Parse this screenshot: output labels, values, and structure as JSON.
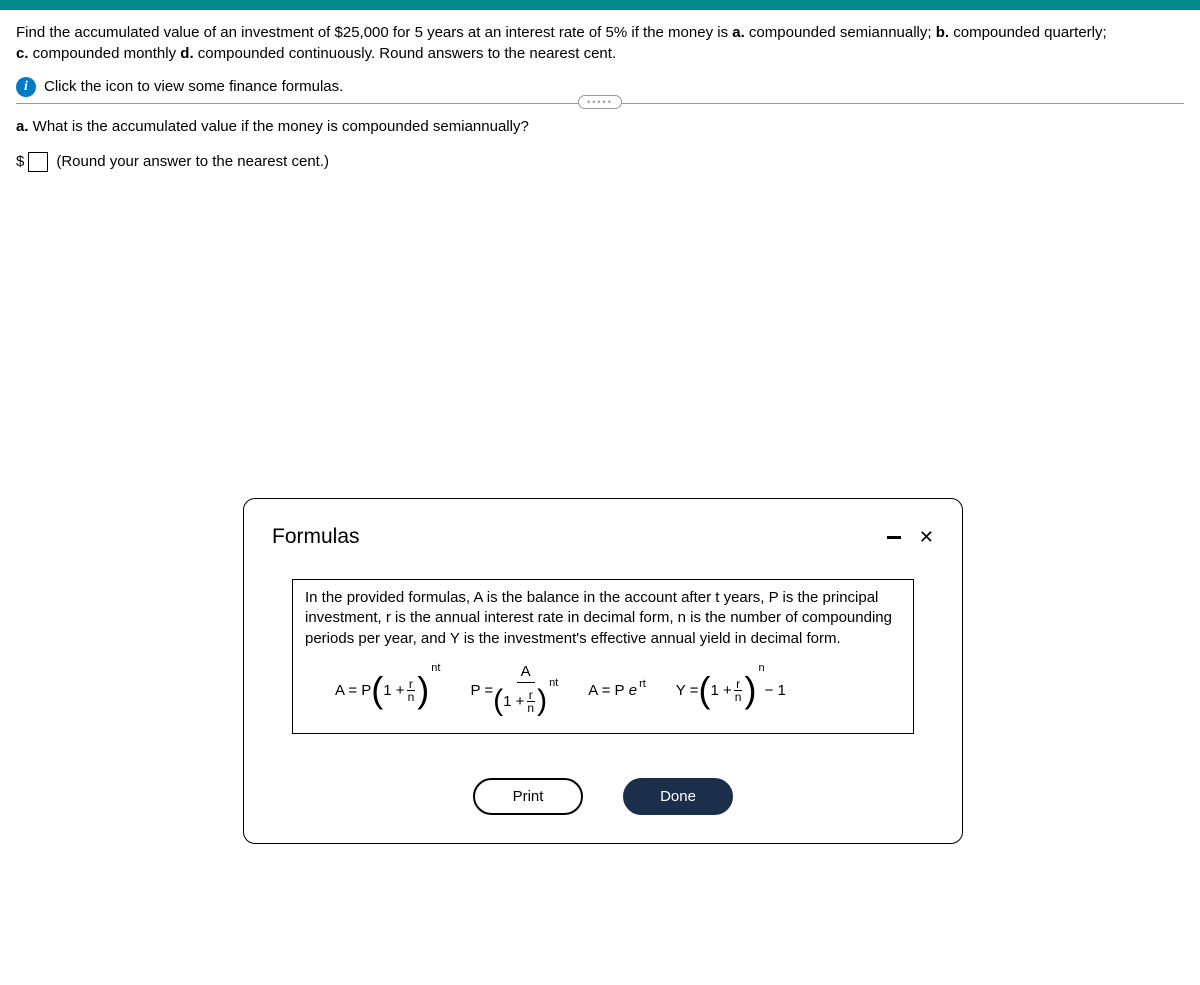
{
  "problem": {
    "intro_pre": "Find the accumulated value of an investment of $25,000 for 5 years at an interest rate of 5% if the money is ",
    "part_a_label": "a.",
    "part_a_text": " compounded semiannually; ",
    "part_b_label": "b.",
    "part_b_text": " compounded quarterly; ",
    "part_c_label": "c.",
    "part_c_text": " compounded monthly ",
    "part_d_label": "d.",
    "part_d_text": " compounded continuously. Round answers to the nearest cent."
  },
  "info_link": "Click the icon to view some finance formulas.",
  "question": {
    "label": "a.",
    "text": " What is the accumulated value if the money is compounded semiannually?"
  },
  "answer": {
    "currency": "$",
    "note": "(Round your answer to the nearest cent.)"
  },
  "modal": {
    "title": "Formulas",
    "description": "In the provided formulas, A is the balance in the account after t years, P is the principal investment, r is the annual interest rate in decimal form, n is the number of compounding periods per year, and Y is the investment's effective annual yield in decimal form.",
    "print_label": "Print",
    "done_label": "Done"
  },
  "formulas": {
    "f1_lhs": "A = P",
    "f2_lhs": "P = ",
    "f2_num": "A",
    "f3": "A = P",
    "f3_e": "e",
    "f3_exp": "rt",
    "f4_lhs": "Y = ",
    "one_plus": "1 + ",
    "r": "r",
    "n": "n",
    "nt": "nt",
    "n_exp": "n",
    "minus1": " − 1"
  }
}
